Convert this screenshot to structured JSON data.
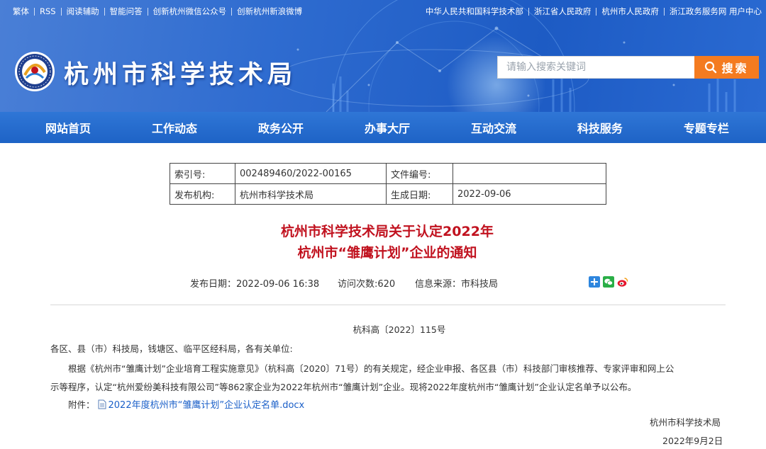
{
  "topbar": {
    "left_links": [
      "繁体",
      "RSS",
      "阅读辅助",
      "智能问答",
      "创新杭州微信公众号",
      "创新杭州新浪微博"
    ],
    "right_links": [
      "中华人民共和国科学技术部",
      "浙江省人民政府",
      "杭州市人民政府",
      "浙江政务服务网 用户中心"
    ]
  },
  "header": {
    "site_title": "杭州市科学技术局"
  },
  "search": {
    "placeholder": "请输入搜索关键词",
    "button_label": "搜索"
  },
  "nav": {
    "items": [
      "网站首页",
      "工作动态",
      "政务公开",
      "办事大厅",
      "互动交流",
      "科技服务",
      "专题专栏"
    ]
  },
  "info_table": {
    "index_label": "索引号:",
    "index_value": "002489460/2022-00165",
    "docno_label": "文件编号:",
    "docno_value": "",
    "org_label": "发布机构:",
    "org_value": "杭州市科学技术局",
    "date_label": "生成日期:",
    "date_value": "2022-09-06"
  },
  "article": {
    "title_line1": "杭州市科学技术局关于认定2022年",
    "title_line2": "杭州市“雏鹰计划”企业的通知",
    "publish_date": "发布日期：2022-09-06 16:38",
    "visits": "访问次数:620",
    "source": "信息来源：市科技局",
    "doc_number": "杭科高〔2022〕115号",
    "salutation": "各区、县（市）科技局，钱塘区、临平区经科局，各有关单位:",
    "para1_line1": "根据《杭州市“雏鹰计划”企业培育工程实施意见》（杭科高〔2020〕71号）的有关规定，经企业申报、各区县（市）科技部门审核推荐、专家评审和网上公",
    "para1_line2": "示等程序，认定“杭州爱纷美科技有限公司”等862家企业为2022年杭州市“雏鹰计划”企业。现将2022年度杭州市“雏鹰计划”企业认定名单予以公布。",
    "attachment_label": "附件：",
    "attachment_name": "2022年度杭州市“雏鹰计划”企业认定名单.docx",
    "signature_org": "杭州市科学技术局",
    "signature_date": "2022年9月2日"
  },
  "colors": {
    "banner_blue": "#2f6cd0",
    "nav_blue": "#1e63c6",
    "search_orange": "#f47b20",
    "title_red": "#c1121f",
    "link_blue": "#1a5fc8"
  }
}
